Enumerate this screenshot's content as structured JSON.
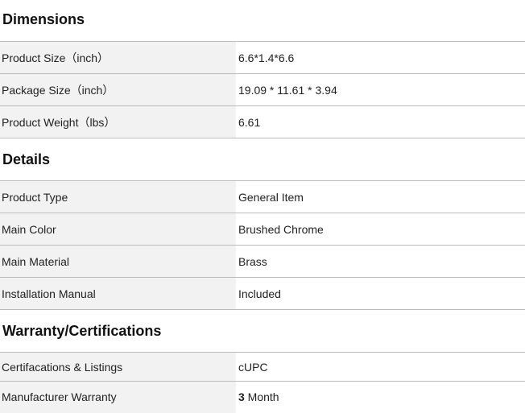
{
  "dimensions": {
    "title": "Dimensions",
    "rows": [
      {
        "label": "Product Size（inch）",
        "value": "6.6*1.4*6.6"
      },
      {
        "label": "Package Size（inch）",
        "value": "19.09 * 11.61 * 3.94"
      },
      {
        "label": "Product Weight（lbs）",
        "value": "6.61"
      }
    ]
  },
  "details": {
    "title": "Details",
    "rows": [
      {
        "label": "Product Type",
        "value": "General Item"
      },
      {
        "label": "Main Color",
        "value": "Brushed Chrome"
      },
      {
        "label": "Main Material",
        "value": "Brass"
      },
      {
        "label": "Installation Manual",
        "value": "Included"
      }
    ]
  },
  "warranty": {
    "title": "Warranty/Certifications",
    "rows": [
      {
        "label": "Certifacations & Listings",
        "value": "cUPC"
      },
      {
        "label": "Manufacturer Warranty",
        "value_number": "3",
        "value_unit": " Month"
      }
    ]
  }
}
